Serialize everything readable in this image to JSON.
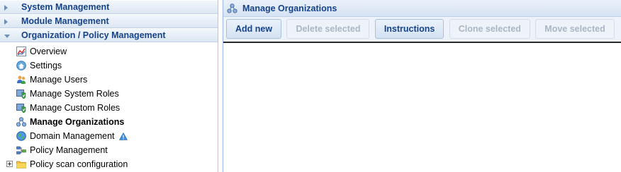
{
  "sidebar": {
    "sections": [
      {
        "label": "System Management",
        "expanded": false
      },
      {
        "label": "Module Management",
        "expanded": false
      },
      {
        "label": "Organization / Policy Management",
        "expanded": true
      }
    ],
    "items": [
      {
        "label": "Overview",
        "icon": "chart-icon"
      },
      {
        "label": "Settings",
        "icon": "settings-house-icon"
      },
      {
        "label": "Manage Users",
        "icon": "users-icon"
      },
      {
        "label": "Manage System Roles",
        "icon": "shield-check-icon"
      },
      {
        "label": "Manage Custom Roles",
        "icon": "shield-check-icon"
      },
      {
        "label": "Manage Organizations",
        "icon": "organizations-icon",
        "selected": true
      },
      {
        "label": "Domain Management",
        "icon": "globe-icon",
        "badge": "warning-icon"
      },
      {
        "label": "Policy Management",
        "icon": "policy-tree-icon"
      },
      {
        "label": "Policy scan configuration",
        "icon": "folder-icon",
        "expandable": true
      }
    ]
  },
  "main": {
    "title": "Manage Organizations",
    "toolbar": {
      "add_new": "Add new",
      "delete_selected": "Delete selected",
      "instructions": "Instructions",
      "clone_selected": "Clone selected",
      "move_selected": "Move selected"
    }
  },
  "colors": {
    "header_text": "#15428b",
    "disabled_text": "#a9b6c6",
    "panel_border": "#99bbe8"
  }
}
